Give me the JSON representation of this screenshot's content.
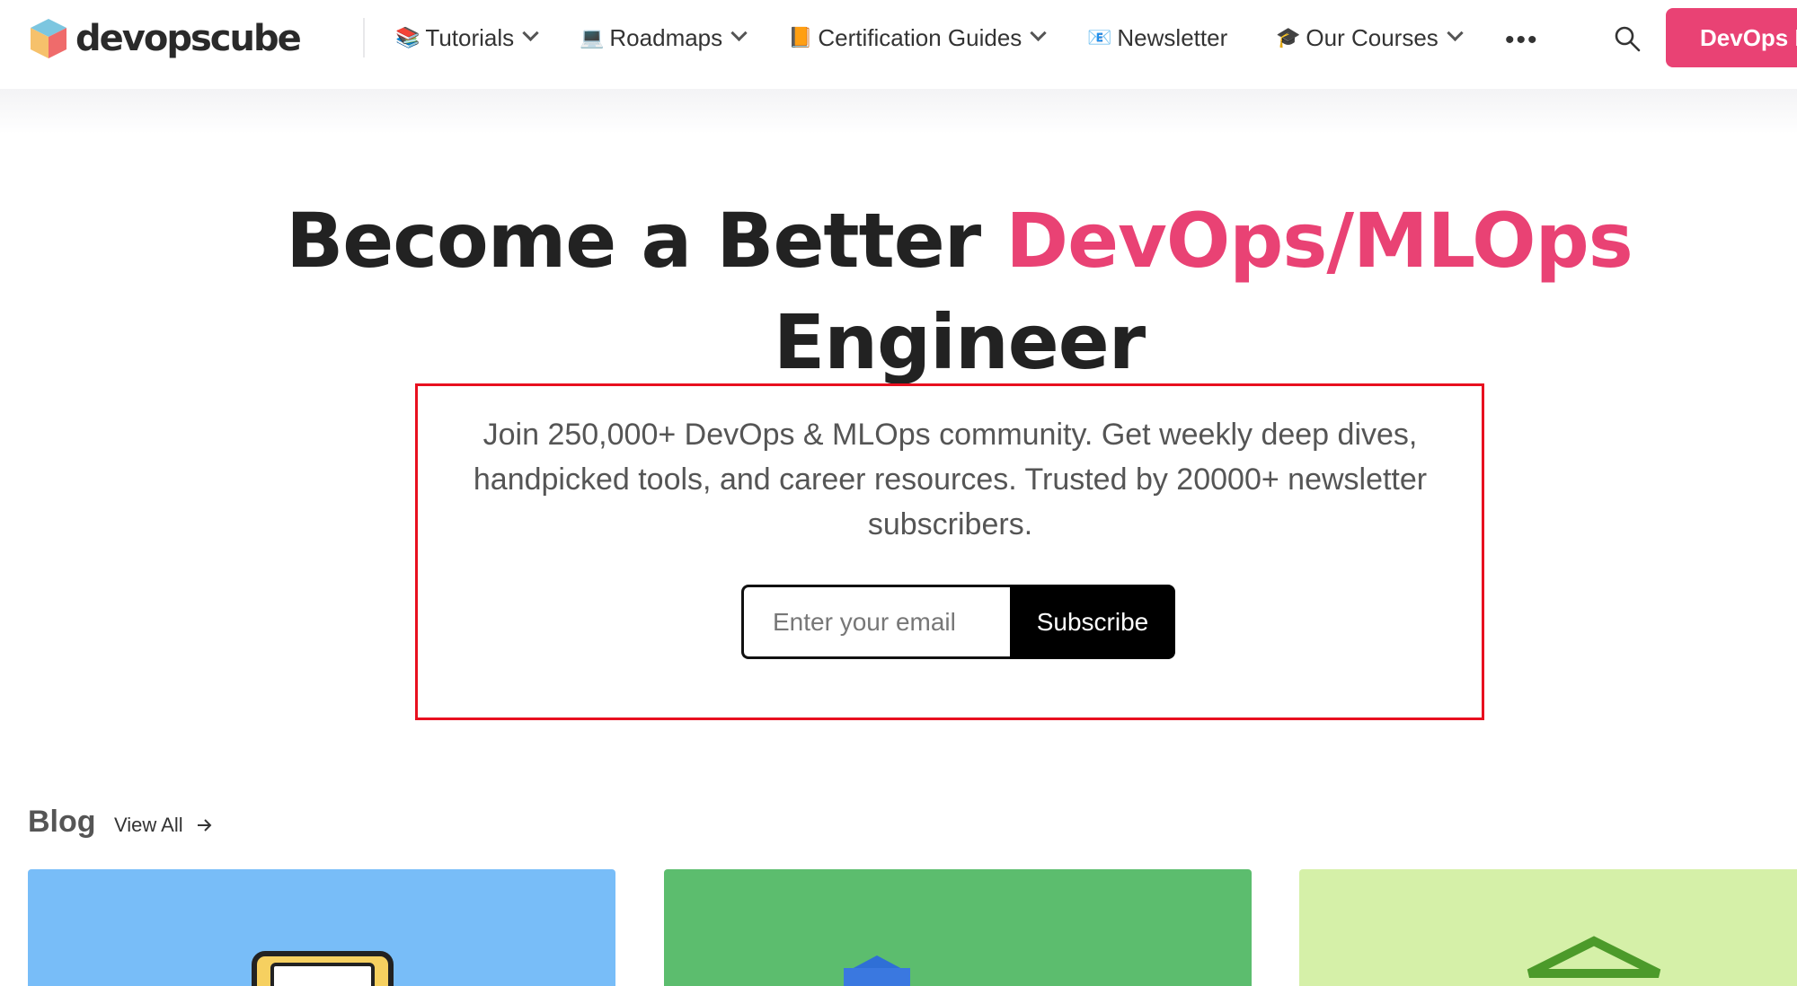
{
  "brand": {
    "logo_text": "devopscube"
  },
  "nav": {
    "items": [
      {
        "emoji": "📚",
        "label": "Tutorials",
        "has_dropdown": true
      },
      {
        "emoji": "💻",
        "label": "Roadmaps",
        "has_dropdown": true
      },
      {
        "emoji": "📙",
        "label": "Certification Guides",
        "has_dropdown": true
      },
      {
        "emoji": "📧",
        "label": "Newsletter",
        "has_dropdown": false
      },
      {
        "emoji": "🎓",
        "label": "Our Courses",
        "has_dropdown": true
      }
    ],
    "more_icon": "more-dots-icon",
    "search_icon": "search-icon",
    "cta_label": "DevOps I"
  },
  "hero": {
    "title_part1": "Become a Better",
    "title_accent": "DevOps/MLOps",
    "title_part2": "Engineer",
    "description": "Join 250,000+ DevOps & MLOps community. Get weekly deep dives, handpicked tools, and career resources. Trusted by 20000+ newsletter subscribers.",
    "email_placeholder": "Enter your email",
    "subscribe_label": "Subscribe"
  },
  "blog": {
    "title": "Blog",
    "view_all_label": "View All"
  },
  "colors": {
    "accent": "#e94274",
    "highlight_border": "#e8101f",
    "button_bg": "#000000"
  }
}
